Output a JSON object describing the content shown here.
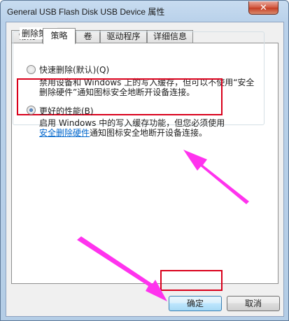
{
  "window": {
    "title": "General USB Flash Disk USB Device 属性",
    "close_label": "✕"
  },
  "tabs": [
    {
      "label": "常规"
    },
    {
      "label": "策略",
      "selected": true
    },
    {
      "label": "卷"
    },
    {
      "label": "驱动程序"
    },
    {
      "label": "详细信息"
    }
  ],
  "policy": {
    "group_title": "删除策略",
    "quick_removal": {
      "label": "快速删除(默认)(Q)",
      "selected": false,
      "desc_line1": "禁用设备和 Windows 上的写入缓存，但可以不使用“安全",
      "desc_line2": "删除硬件”通知图标安全地断开设备连接。"
    },
    "better_performance": {
      "label": "更好的性能(B)",
      "selected": true,
      "desc_line1": "启用 Windows 中的写入缓存功能，但您必须使用",
      "desc_link": "安全删除硬件",
      "desc_line2_rest": "通知图标安全地断开设备连接。"
    }
  },
  "buttons": {
    "ok": "确定",
    "cancel": "取消"
  },
  "colors": {
    "highlight": "#d9001b",
    "arrow": "#ff33ee"
  }
}
